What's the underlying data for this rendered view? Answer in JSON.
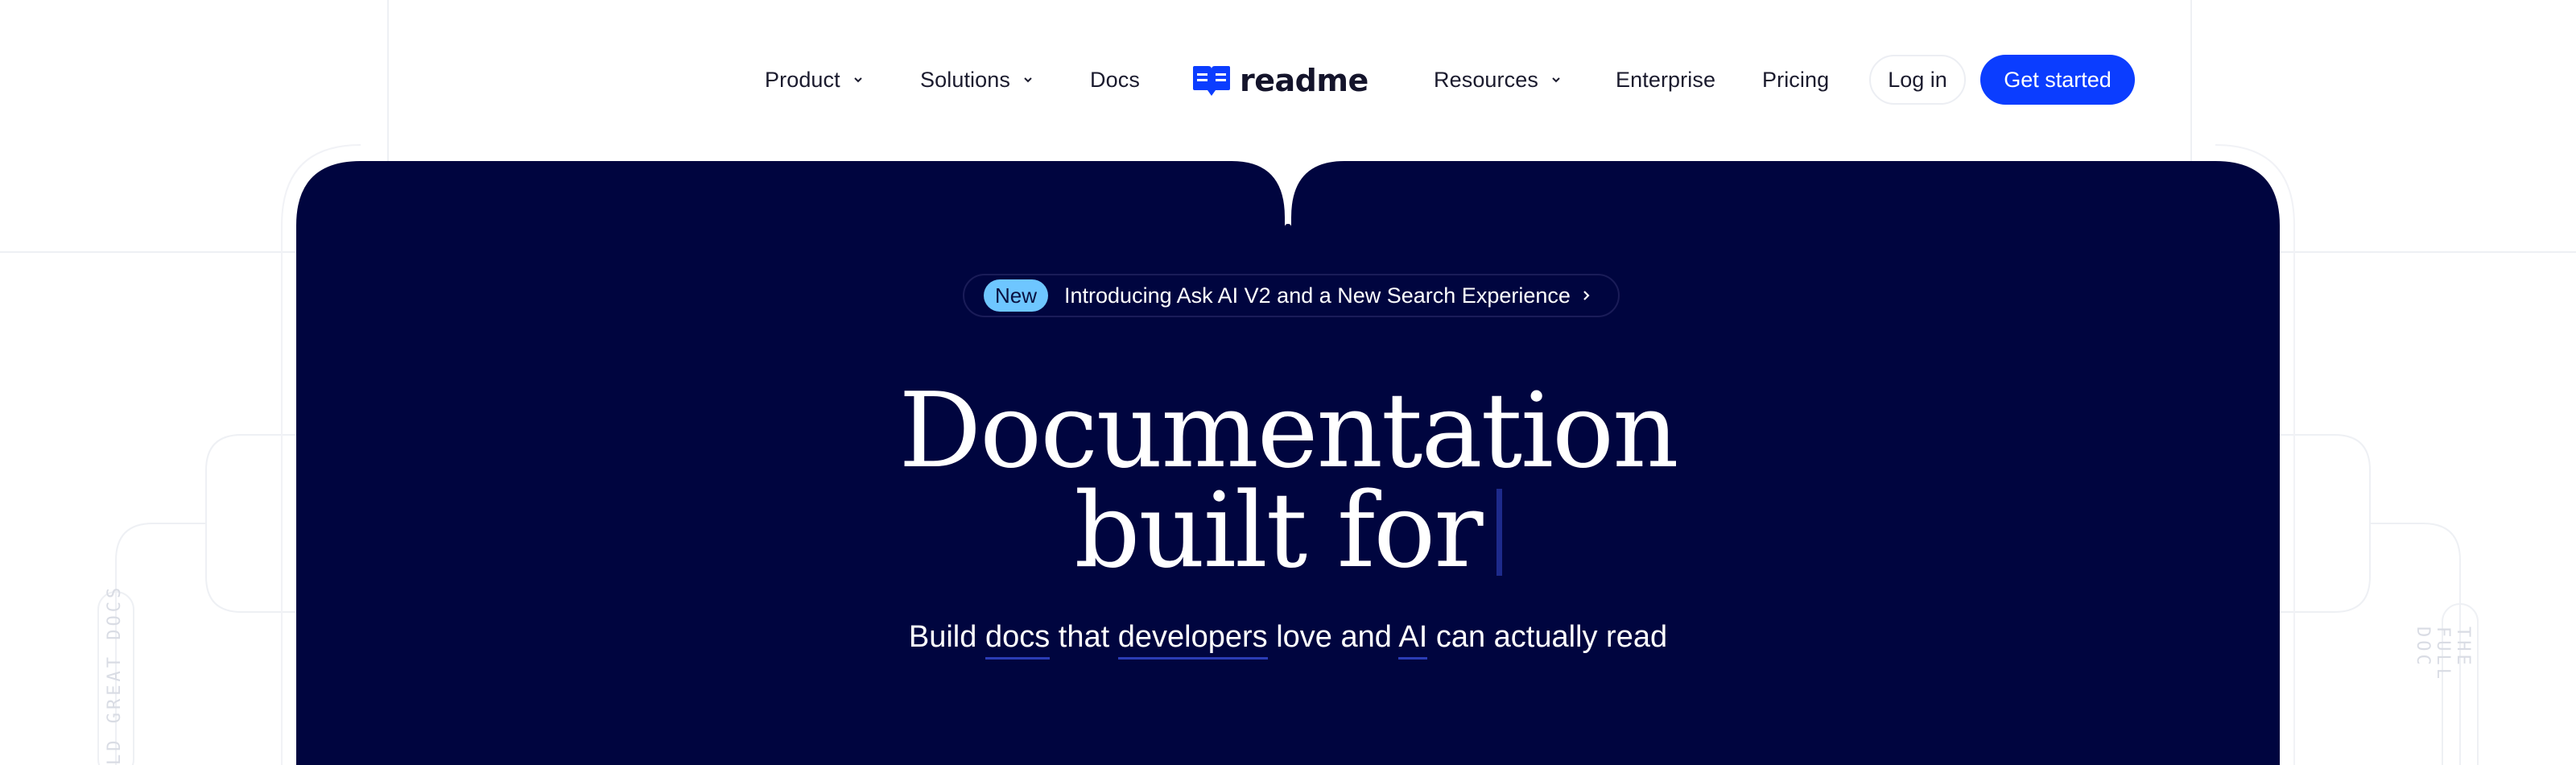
{
  "nav": {
    "product": "Product",
    "solutions": "Solutions",
    "docs": "Docs",
    "logo_text": "readme",
    "resources": "Resources",
    "enterprise": "Enterprise",
    "pricing": "Pricing",
    "login": "Log in",
    "get_started": "Get started"
  },
  "hero": {
    "badge": "New",
    "announcement": "Introducing Ask AI V2 and a New Search Experience",
    "headline_line1": "Documentation",
    "headline_line2": "built for",
    "sub_before": "Build",
    "sub_docs": "docs",
    "sub_mid": "that",
    "sub_developers": "developers",
    "sub_mid2": "love and",
    "sub_ai": "AI",
    "sub_end": "can actually read"
  },
  "side": {
    "left": "LD GREAT DOCS",
    "right": "THE FULL DOC"
  },
  "colors": {
    "brand_blue": "#0b3dff",
    "hero_navy": "#00053f",
    "badge_blue": "#6ec6ff"
  }
}
